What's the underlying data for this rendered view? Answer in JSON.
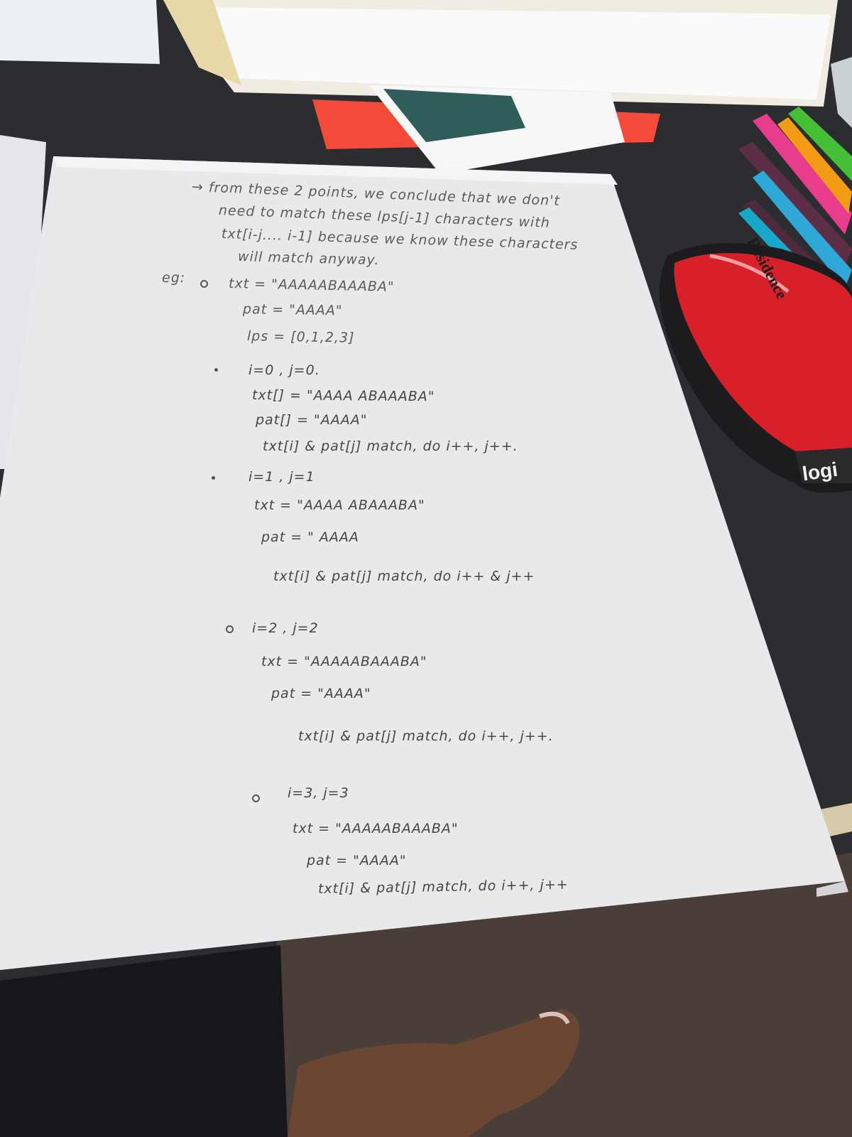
{
  "scene": {
    "description_label": "Photo of handwritten notes on a desk",
    "colors": {
      "desk": "#2b2d31",
      "paper": "#e9e9ec",
      "ink": "#454545",
      "mouse_red": "#d8202a",
      "carpet": "#4a3f38"
    }
  },
  "notes": {
    "line1": "→ from these 2 points, we conclude that we don't",
    "line2": "need to match these lps[j-1] characters with",
    "line3": "txt[i-j.... i-1] because we know these characters",
    "line4": "will match anyway.",
    "eg_label": "eg:",
    "ex_txt": "txt = \"AAAAABAAABA\"",
    "ex_pat": "pat = \"AAAA\"",
    "ex_lps": "lps = [0,1,2,3]",
    "s1_head": "i=0 , j=0.",
    "s1_txt": "txt[] = \"AAAA ABAAABA\"",
    "s1_pat": "pat[] = \"AAAA\"",
    "s1_note": "txt[i] & pat[j] match, do i++, j++.",
    "s2_head": "i=1 , j=1",
    "s2_txt": "txt = \"AAAA ABAAABA\"",
    "s2_pat": "pat = \" AAAA",
    "s2_note": "txt[i] & pat[j] match, do i++ & j++",
    "s3_head": "i=2 , j=2",
    "s3_txt": "txt = \"AAAAABAAABA\"",
    "s3_pat": "pat = \"AAAA\"",
    "s3_note": "txt[i] & pat[j] match, do i++, j++.",
    "s4_head": "i=3, j=3",
    "s4_txt": "txt = \"AAAAABAAABA\"",
    "s4_pat": "pat = \"AAAA\"",
    "s4_note": "txt[i] & pat[j] match, do i++, j++"
  },
  "objects": {
    "mouse_logo": "logi",
    "pencil_brand": "Residence"
  }
}
